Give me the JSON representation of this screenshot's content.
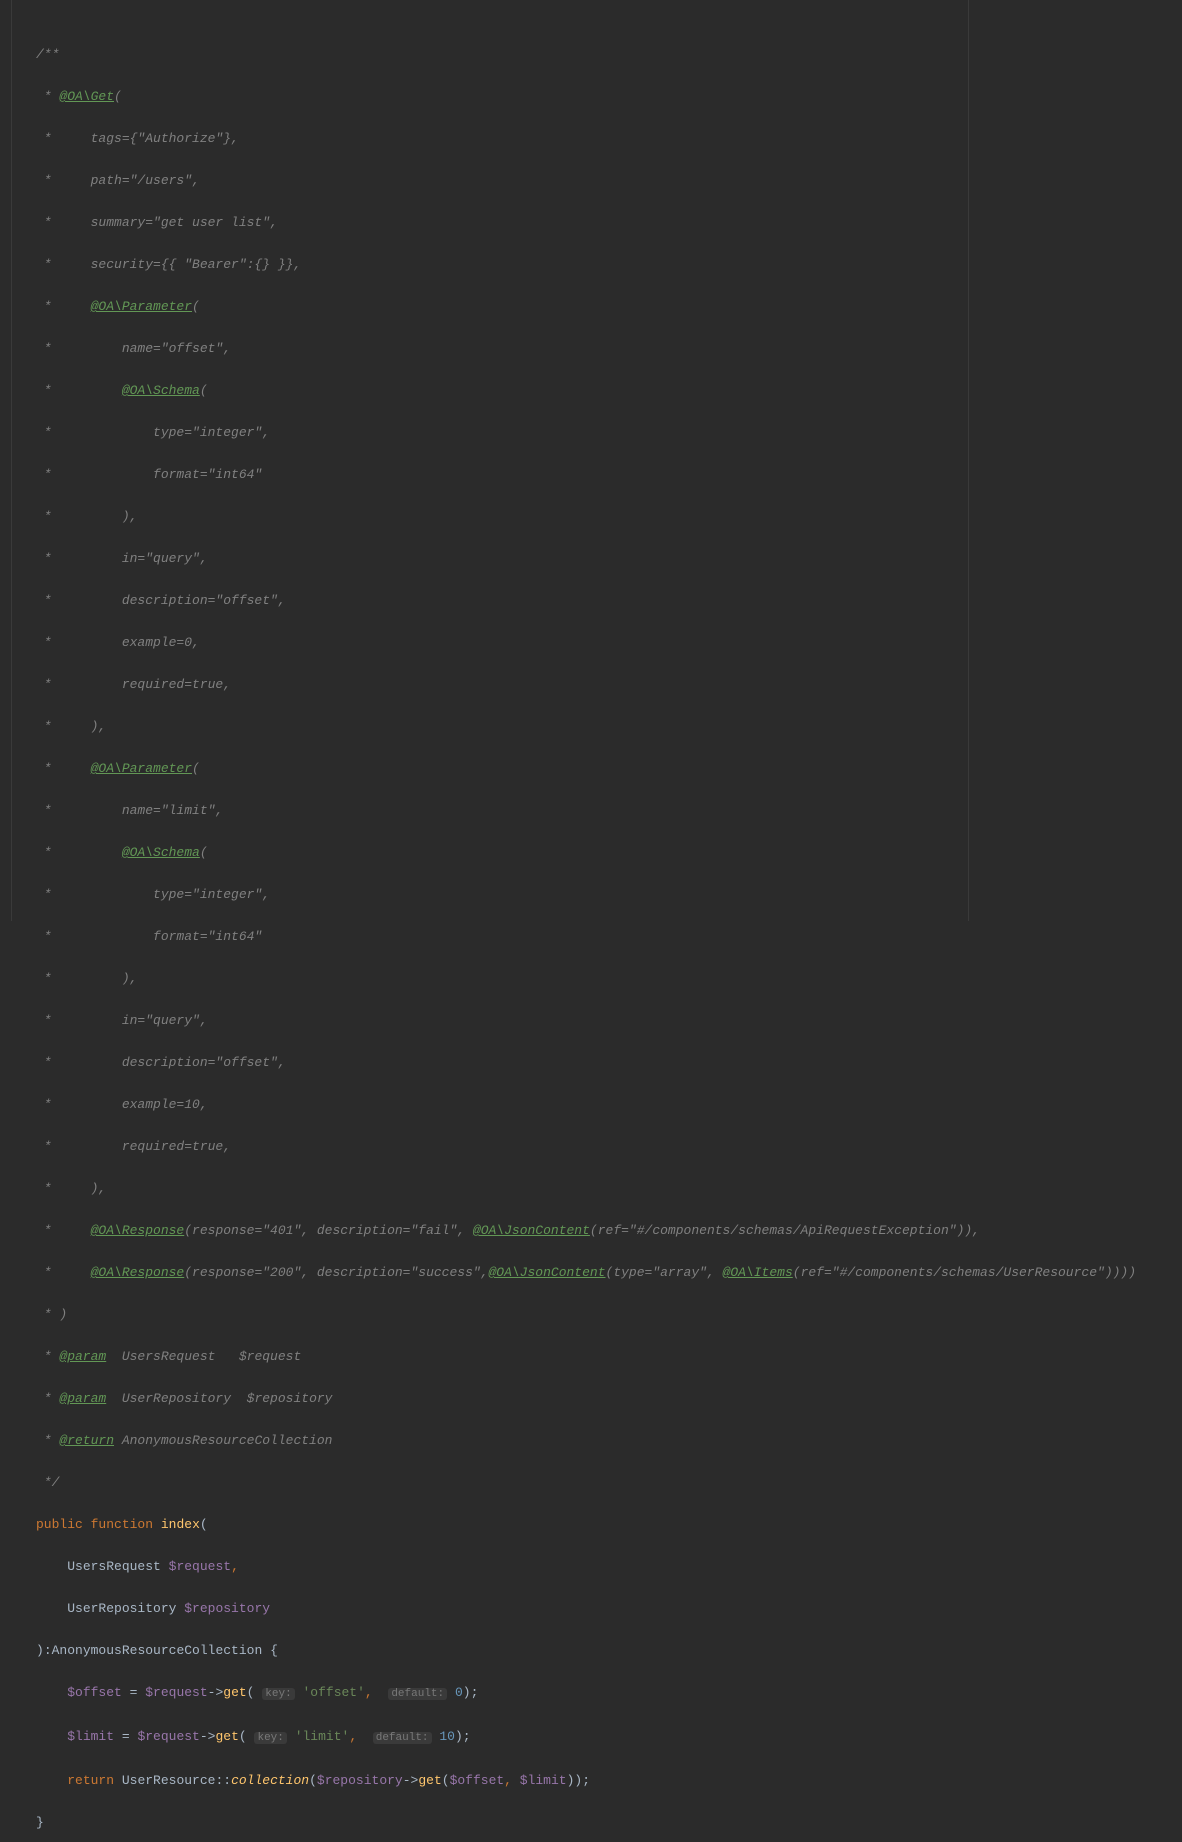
{
  "code": {
    "l1": "/**",
    "l2_pre": " * ",
    "l2_tag": "@OA\\Get",
    "l2_post": "(",
    "l3": " *     tags={\"Authorize\"},",
    "l4": " *     path=\"/users\",",
    "l5": " *     summary=\"get user list\",",
    "l6": " *     security={{ \"Bearer\":{} }},",
    "l7_pre": " *     ",
    "l7_tag": "@OA\\Parameter",
    "l7_post": "(",
    "l8": " *         name=\"offset\",",
    "l9_pre": " *         ",
    "l9_tag": "@OA\\Schema",
    "l9_post": "(",
    "l10": " *             type=\"integer\",",
    "l11": " *             format=\"int64\"",
    "l12": " *         ),",
    "l13": " *         in=\"query\",",
    "l14": " *         description=\"offset\",",
    "l15": " *         example=0,",
    "l16": " *         required=true,",
    "l17": " *     ),",
    "l18_pre": " *     ",
    "l18_tag": "@OA\\Parameter",
    "l18_post": "(",
    "l19": " *         name=\"limit\",",
    "l20_pre": " *         ",
    "l20_tag": "@OA\\Schema",
    "l20_post": "(",
    "l21": " *             type=\"integer\",",
    "l22": " *             format=\"int64\"",
    "l23": " *         ),",
    "l24": " *         in=\"query\",",
    "l25": " *         description=\"offset\",",
    "l26": " *         example=10,",
    "l27": " *         required=true,",
    "l28": " *     ),",
    "l29_pre": " *     ",
    "l29_tag1": "@OA\\Response",
    "l29_mid1": "(response=\"401\", description=\"fail\", ",
    "l29_tag2": "@OA\\JsonContent",
    "l29_post": "(ref=\"#/components/schemas/ApiRequestException\")),",
    "l30_pre": " *     ",
    "l30_tag1": "@OA\\Response",
    "l30_mid1": "(response=\"200\", description=\"success\",",
    "l30_tag2": "@OA\\JsonContent",
    "l30_mid2": "(type=\"array\", ",
    "l30_tag3": "@OA\\Items",
    "l30_post": "(ref=\"#/components/schemas/UserResource\"))))",
    "l31": " * )",
    "l32_pre": " * ",
    "l32_tag": "@param",
    "l32_post": "  UsersRequest   ",
    "l32_var": "$request",
    "l33_pre": " * ",
    "l33_tag": "@param",
    "l33_post": "  UserRepository  ",
    "l33_var": "$repository",
    "l34_pre": " * ",
    "l34_tag": "@return",
    "l34_post": " AnonymousResourceCollection",
    "l35": " */",
    "l36_kw1": "public",
    "l36_kw2": "function",
    "l36_fn": "index",
    "l36_paren": "(",
    "l37_type": "UsersRequest",
    "l37_var": "$request",
    "l37_comma": ",",
    "l38_type": "UserRepository",
    "l38_var": "$repository",
    "l39_close": ")",
    "l39_colon": ":",
    "l39_ret": "AnonymousResourceCollection",
    "l39_brace": " {",
    "l40_var1": "$offset",
    "l40_eq": " = ",
    "l40_var2": "$request",
    "l40_arrow": "->",
    "l40_get": "get",
    "l40_p1": "( ",
    "l40_hint1": "key:",
    "l40_str": "'offset'",
    "l40_comma": ",  ",
    "l40_hint2": "default:",
    "l40_num": "0",
    "l40_end": ");",
    "l41_var1": "$limit",
    "l41_eq": " = ",
    "l41_var2": "$request",
    "l41_arrow": "->",
    "l41_get": "get",
    "l41_p1": "( ",
    "l41_hint1": "key:",
    "l41_str": "'limit'",
    "l41_comma": ",  ",
    "l41_hint2": "default:",
    "l41_num": "10",
    "l41_end": ");",
    "l42_kw": "return",
    "l42_cls": "UserResource",
    "l42_dcol": "::",
    "l42_method": "collection",
    "l42_p1": "(",
    "l42_var1": "$repository",
    "l42_arrow": "->",
    "l42_get": "get",
    "l42_p2": "(",
    "l42_var2": "$offset",
    "l42_comma": ", ",
    "l42_var3": "$limit",
    "l42_end": "));",
    "l43": "}"
  }
}
